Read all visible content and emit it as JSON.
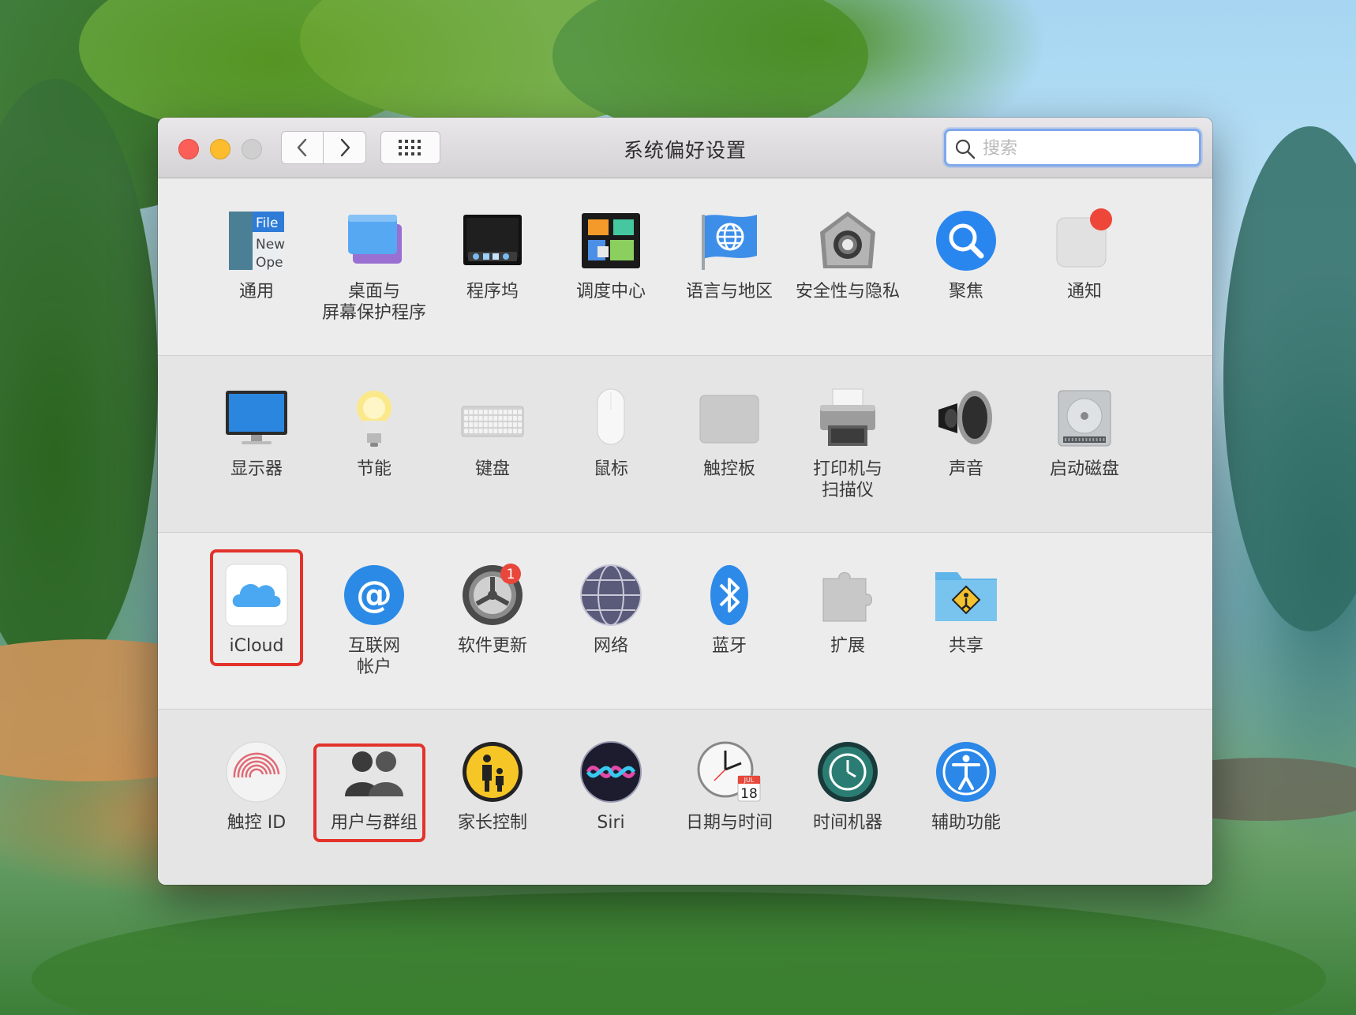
{
  "window": {
    "title": "系统偏好设置",
    "search_placeholder": "搜索"
  },
  "rows": [
    [
      {
        "id": "general",
        "label": "通用",
        "icon": "general-icon"
      },
      {
        "id": "desktop",
        "label": "桌面与\n屏幕保护程序",
        "icon": "desktop-screensaver-icon"
      },
      {
        "id": "dock",
        "label": "程序坞",
        "icon": "dock-icon"
      },
      {
        "id": "mission",
        "label": "调度中心",
        "icon": "mission-control-icon"
      },
      {
        "id": "language",
        "label": "语言与地区",
        "icon": "language-region-icon"
      },
      {
        "id": "security",
        "label": "安全性与隐私",
        "icon": "security-privacy-icon"
      },
      {
        "id": "spotlight",
        "label": "聚焦",
        "icon": "spotlight-icon"
      },
      {
        "id": "notifications",
        "label": "通知",
        "icon": "notifications-icon"
      }
    ],
    [
      {
        "id": "displays",
        "label": "显示器",
        "icon": "display-icon"
      },
      {
        "id": "energy",
        "label": "节能",
        "icon": "energy-saver-icon"
      },
      {
        "id": "keyboard",
        "label": "键盘",
        "icon": "keyboard-icon"
      },
      {
        "id": "mouse",
        "label": "鼠标",
        "icon": "mouse-icon"
      },
      {
        "id": "trackpad",
        "label": "触控板",
        "icon": "trackpad-icon"
      },
      {
        "id": "printers",
        "label": "打印机与\n扫描仪",
        "icon": "printer-icon"
      },
      {
        "id": "sound",
        "label": "声音",
        "icon": "sound-icon"
      },
      {
        "id": "startup",
        "label": "启动磁盘",
        "icon": "startup-disk-icon"
      }
    ],
    [
      {
        "id": "icloud",
        "label": "iCloud",
        "icon": "icloud-icon"
      },
      {
        "id": "internet",
        "label": "互联网\n帐户",
        "icon": "internet-accounts-icon"
      },
      {
        "id": "update",
        "label": "软件更新",
        "icon": "software-update-icon",
        "badge": "1"
      },
      {
        "id": "network",
        "label": "网络",
        "icon": "network-icon"
      },
      {
        "id": "bluetooth",
        "label": "蓝牙",
        "icon": "bluetooth-icon"
      },
      {
        "id": "extensions",
        "label": "扩展",
        "icon": "extensions-icon"
      },
      {
        "id": "sharing",
        "label": "共享",
        "icon": "sharing-icon"
      }
    ],
    [
      {
        "id": "touchid",
        "label": "触控 ID",
        "icon": "touch-id-icon"
      },
      {
        "id": "users",
        "label": "用户与群组",
        "icon": "users-groups-icon"
      },
      {
        "id": "parental",
        "label": "家长控制",
        "icon": "parental-controls-icon"
      },
      {
        "id": "siri",
        "label": "Siri",
        "icon": "siri-icon"
      },
      {
        "id": "datetime",
        "label": "日期与时间",
        "icon": "date-time-icon",
        "calendar_month": "JUL",
        "calendar_day": "18"
      },
      {
        "id": "timemachine",
        "label": "时间机器",
        "icon": "time-machine-icon"
      },
      {
        "id": "accessibility",
        "label": "辅助功能",
        "icon": "accessibility-icon"
      }
    ]
  ],
  "general_icon_text": [
    "File",
    "New",
    "Ope"
  ],
  "highlighted": [
    "icloud",
    "users"
  ],
  "colors": {
    "highlight": "#e3322b",
    "accent": "#7fa8ec"
  }
}
